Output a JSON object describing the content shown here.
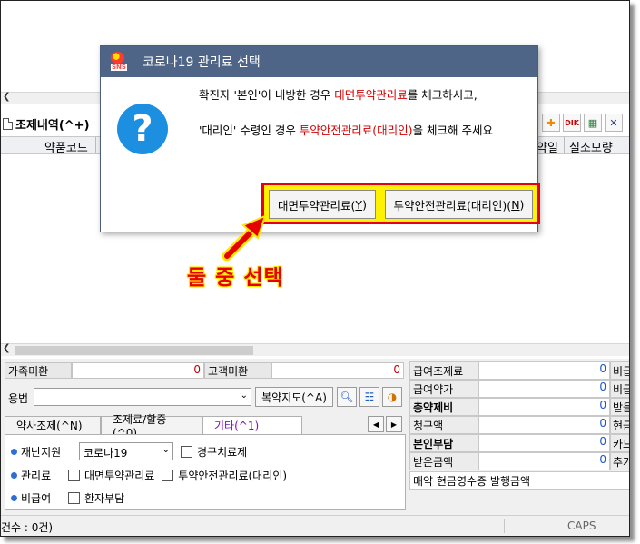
{
  "top": {
    "section_title": "조제내역(^+)",
    "grid_headers": [
      "약품코드",
      "약일",
      "실소모량"
    ]
  },
  "dialog": {
    "title": "코로나19 관리료 선택",
    "logo_text": "SNS",
    "line1_a": "확진자 '본인'이 내방한 경우 ",
    "line1_red": "대면투약관리료",
    "line1_b": "를 체크하시고,",
    "line2_a": "'대리인' 수령인 경우 ",
    "line2_red": "투약안전관리료(대리인)",
    "line2_b": "을 체크해 주세요",
    "btn1_label": "대면투약관리료(",
    "btn1_key": "Y",
    "btn2_label": "투약안전관리료(대리인)(",
    "btn2_key": "N",
    "close_paren": ")"
  },
  "annotation": {
    "text": "둘 중 선택"
  },
  "bottom": {
    "family_label": "가족미환",
    "family_value": "0",
    "customer_label": "고객미환",
    "customer_value": "0",
    "usage_label": "용법",
    "usage_value": "",
    "guide_button": "복약지도(^A)",
    "tabs": [
      "약사조제(^N)",
      "조제료/할증(^0)",
      "기타(^1)"
    ],
    "options": {
      "support_label": "재난지원",
      "support_value": "코로나19",
      "light_treatment": "경구치료제",
      "mgmt_label": "관리료",
      "face_mgmt": "대면투약관리료",
      "safety_mgmt": "투약안전관리료(대리인)",
      "nonbenefit_label": "비급여",
      "patient_pay": "환자부담"
    },
    "right_grid": [
      {
        "label": "급여조제료",
        "value": "0",
        "tail": "비급"
      },
      {
        "label": "급여약가",
        "value": "0",
        "tail": "비급"
      },
      {
        "label": "총약제비",
        "value": "0",
        "tail": "받을"
      },
      {
        "label": "청구액",
        "value": "0",
        "tail": "현금"
      },
      {
        "label": "본인부담",
        "value": "0",
        "tail": "카드"
      },
      {
        "label": "받은금액",
        "value": "0",
        "tail": "추가"
      }
    ],
    "receipt_label": "매약 현금영수증 발행금액"
  },
  "statusbar": {
    "count": "건수 : 0건)",
    "caps": "CAPS"
  },
  "colors": {
    "title_bar": "#4e6587",
    "highlight": "#fff200",
    "annotation_red": "#e60000"
  }
}
